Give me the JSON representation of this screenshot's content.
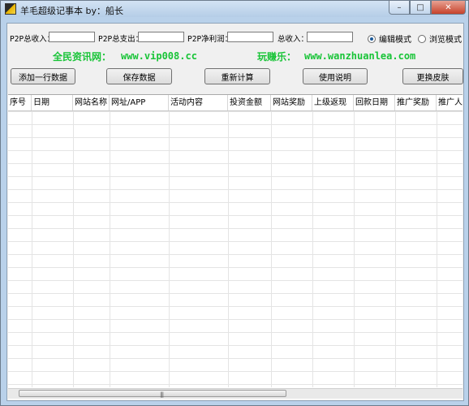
{
  "window": {
    "title": "羊毛超级记事本 by：船长",
    "min_glyph": "–",
    "max_glyph": "□",
    "close_glyph": "✕"
  },
  "fields": [
    {
      "label": "P2P总收入：",
      "value": ""
    },
    {
      "label": "P2P总支出：",
      "value": ""
    },
    {
      "label": "P2P净利润：",
      "value": ""
    },
    {
      "label": "总收入：",
      "value": ""
    }
  ],
  "modes": {
    "edit": "编辑模式",
    "browse": "浏览模式",
    "selected": "edit"
  },
  "banner": {
    "site1_name": "全民资讯网：",
    "site1_url": "www.vip008.cc",
    "site2_name": "玩赚乐：",
    "site2_url": "www.wanzhuanlea.com"
  },
  "buttons": {
    "add_row": "添加一行数据",
    "save": "保存数据",
    "recalc": "重新计算",
    "help": "使用说明",
    "skin": "更换皮肤"
  },
  "table": {
    "columns": [
      "序号",
      "日期",
      "网站名称",
      "网址/APP",
      "活动内容",
      "投资金额",
      "网站奖励",
      "上级返现",
      "回款日期",
      "推广奖励",
      "推广人数"
    ],
    "rows": []
  },
  "scrollbar": {
    "grip": "|||"
  }
}
